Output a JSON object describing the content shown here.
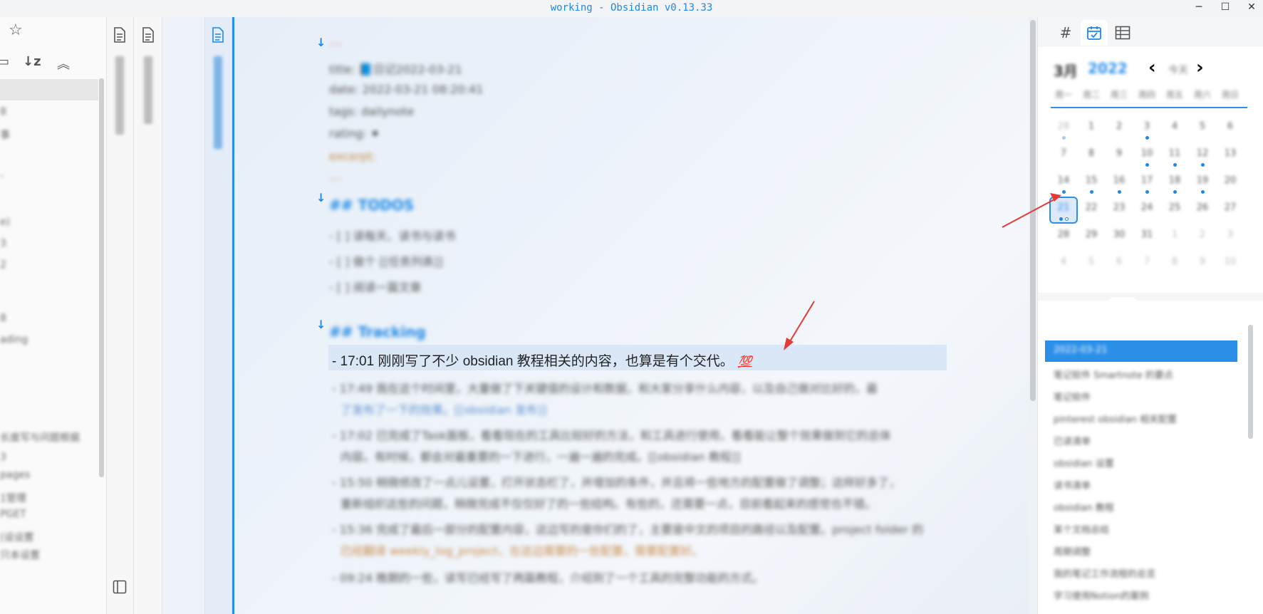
{
  "window": {
    "title": "working - Obsidian v0.13.33",
    "minimize": "─",
    "maximize": "☐",
    "close": "✕"
  },
  "left_pane": {
    "star_icon": "☆",
    "toolbar": {
      "sort_icon": "↓z",
      "collapse_icon": "︽",
      "new_icon": "▭"
    },
    "rows": [
      "8",
      "事",
      "-",
      "e)",
      "3",
      "2",
      "8",
      "ading",
      "长度写与问题根据",
      "3",
      "pages",
      "1管理",
      "PGET",
      "(设设置",
      "只本设置"
    ]
  },
  "strips": {
    "strip1_icon": "document-icon",
    "strip2_icon": "document-icon",
    "strip4_icon": "document-icon",
    "layout_icon": "⊟"
  },
  "editor": {
    "blurred_lines": [
      "---",
      "title: 📘日记2022-03-21",
      "date: 2022-03-21 08:20:41",
      "tags: dailynote",
      "rating: ⚫",
      "excerpt:",
      "---",
      "## TODOS",
      "- [ ] 读每天、读书与读书",
      "- [ ] 做个 [[任务列表]]",
      "- [ ] 阅读一篇文章",
      "## Tracking"
    ],
    "highlighted_text": "- 17:01 刚刚写了不少 obsidian 教程相关的内容，也算是有个交代。",
    "emoji": "💯",
    "tracking_blur": [
      "- 17:49 我在这个时间里，大量做了下关键值的设计和数据，和大家分享什么内容，以及自己做对比好的，最",
      "了发布了一下的效果。[[obsidian 发布]]",
      "- 17:02 已完成了Task面板，看看现在的工具比较好的方法，和工具进行使用，看看能让整个效果做到它的总体",
      "内容。有时候，都会对最重要的一下进行，一遍一遍的完成。[[obsidian 教程]]",
      "- 15:50 稍微修改了一点儿设置，打开状态栏了，并增加的条件，并且将一些地方的配置做了调整；这样好多了，",
      "重新组织这些的问题，稍微完成不仅仅好了的一些结构。有些的，还需要一点，目前看起来的感觉也不错。",
      "- 15:36 完成了最后一部分的配置内容，这边写的是你们的了，主要是中文的项目的路径以及配置。project folder 的",
      "已经翻译 weekly_log_project，在这边需要的一些配置，需要配置好。",
      "- 09:24 晚期的一些，读写已经写了两篇教程，介绍到了一个工具的完整功能的方式。"
    ]
  },
  "right_pane": {
    "tabs": [
      "#",
      "calendar-icon",
      "table-icon"
    ],
    "calendar": {
      "month": "3月",
      "year": "2022",
      "today_label": "今天",
      "weekdays": [
        "周一",
        "周二",
        "周三",
        "周四",
        "周五",
        "周六",
        "周日"
      ],
      "weeks": [
        [
          "28",
          "1",
          "2",
          "3",
          "4",
          "5",
          "6"
        ],
        [
          "7",
          "8",
          "9",
          "10",
          "11",
          "12",
          "13"
        ],
        [
          "14",
          "15",
          "16",
          "17",
          "18",
          "19",
          "20"
        ],
        [
          "21",
          "22",
          "23",
          "24",
          "25",
          "26",
          "27"
        ],
        [
          "28",
          "29",
          "30",
          "31",
          "1",
          "2",
          "3"
        ],
        [
          "4",
          "5",
          "6",
          "7",
          "8",
          "9",
          "10"
        ]
      ]
    },
    "lower_tabs": [
      "outline-icon",
      "backlink-icon",
      "recent-icon"
    ],
    "recent_files": [
      "2022-03-21",
      "笔记软件 Smartnote 的要点",
      "笔记软件",
      "pinterest obsidian 相关配置",
      "已读清单",
      "obsidian 设置",
      "读书清单",
      "obsidian 教程",
      "某个文档总结",
      "周期调整",
      "我的笔记工作流程的总览",
      "学习使用Notion的案例"
    ]
  },
  "colors": {
    "accent": "#2b8fe8",
    "annotation_arrow": "#e53935"
  }
}
